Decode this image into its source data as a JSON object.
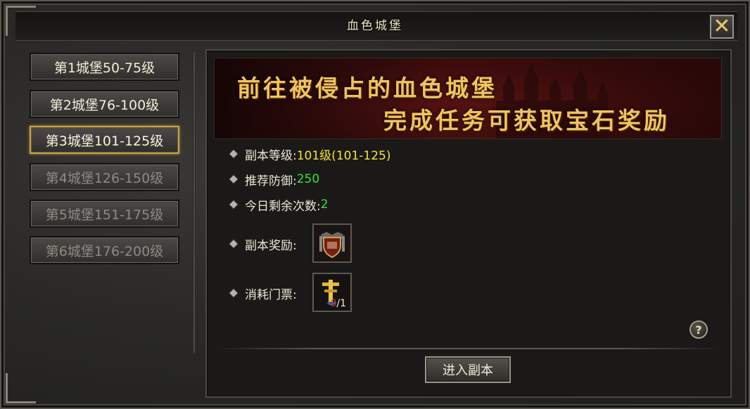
{
  "window": {
    "title": "血色城堡",
    "close_label": "✕"
  },
  "sidebar": {
    "items": [
      {
        "label": "第1城堡50-75级",
        "state": "unlocked"
      },
      {
        "label": "第2城堡76-100级",
        "state": "unlocked"
      },
      {
        "label": "第3城堡101-125级",
        "state": "selected"
      },
      {
        "label": "第4城堡126-150级",
        "state": "locked"
      },
      {
        "label": "第5城堡151-175级",
        "state": "locked"
      },
      {
        "label": "第6城堡176-200级",
        "state": "locked"
      }
    ]
  },
  "banner": {
    "line1": "前往被侵占的血色城堡",
    "line2": "完成任务可获取宝石奖励"
  },
  "info": {
    "level_label": "副本等级:",
    "level_value": "101级(101-125)",
    "defense_label": "推荐防御:",
    "defense_value": "250",
    "remaining_label": "今日剩余次数:",
    "remaining_value": "2",
    "reward_label": "副本奖励:",
    "ticket_label": "消耗门票:",
    "ticket_count": "1",
    "ticket_have": "0"
  },
  "actions": {
    "enter_label": "进入副本",
    "help_label": "?"
  },
  "colors": {
    "value_yellow": "#f2e33a",
    "value_green": "#37e335",
    "banner_text": "#f1c35c",
    "ticket_count_red": "#e03c2c",
    "selected_border": "#c2a24d"
  },
  "icons": {
    "reward": "shield-emblem-icon",
    "ticket": "golden-cross-icon"
  }
}
